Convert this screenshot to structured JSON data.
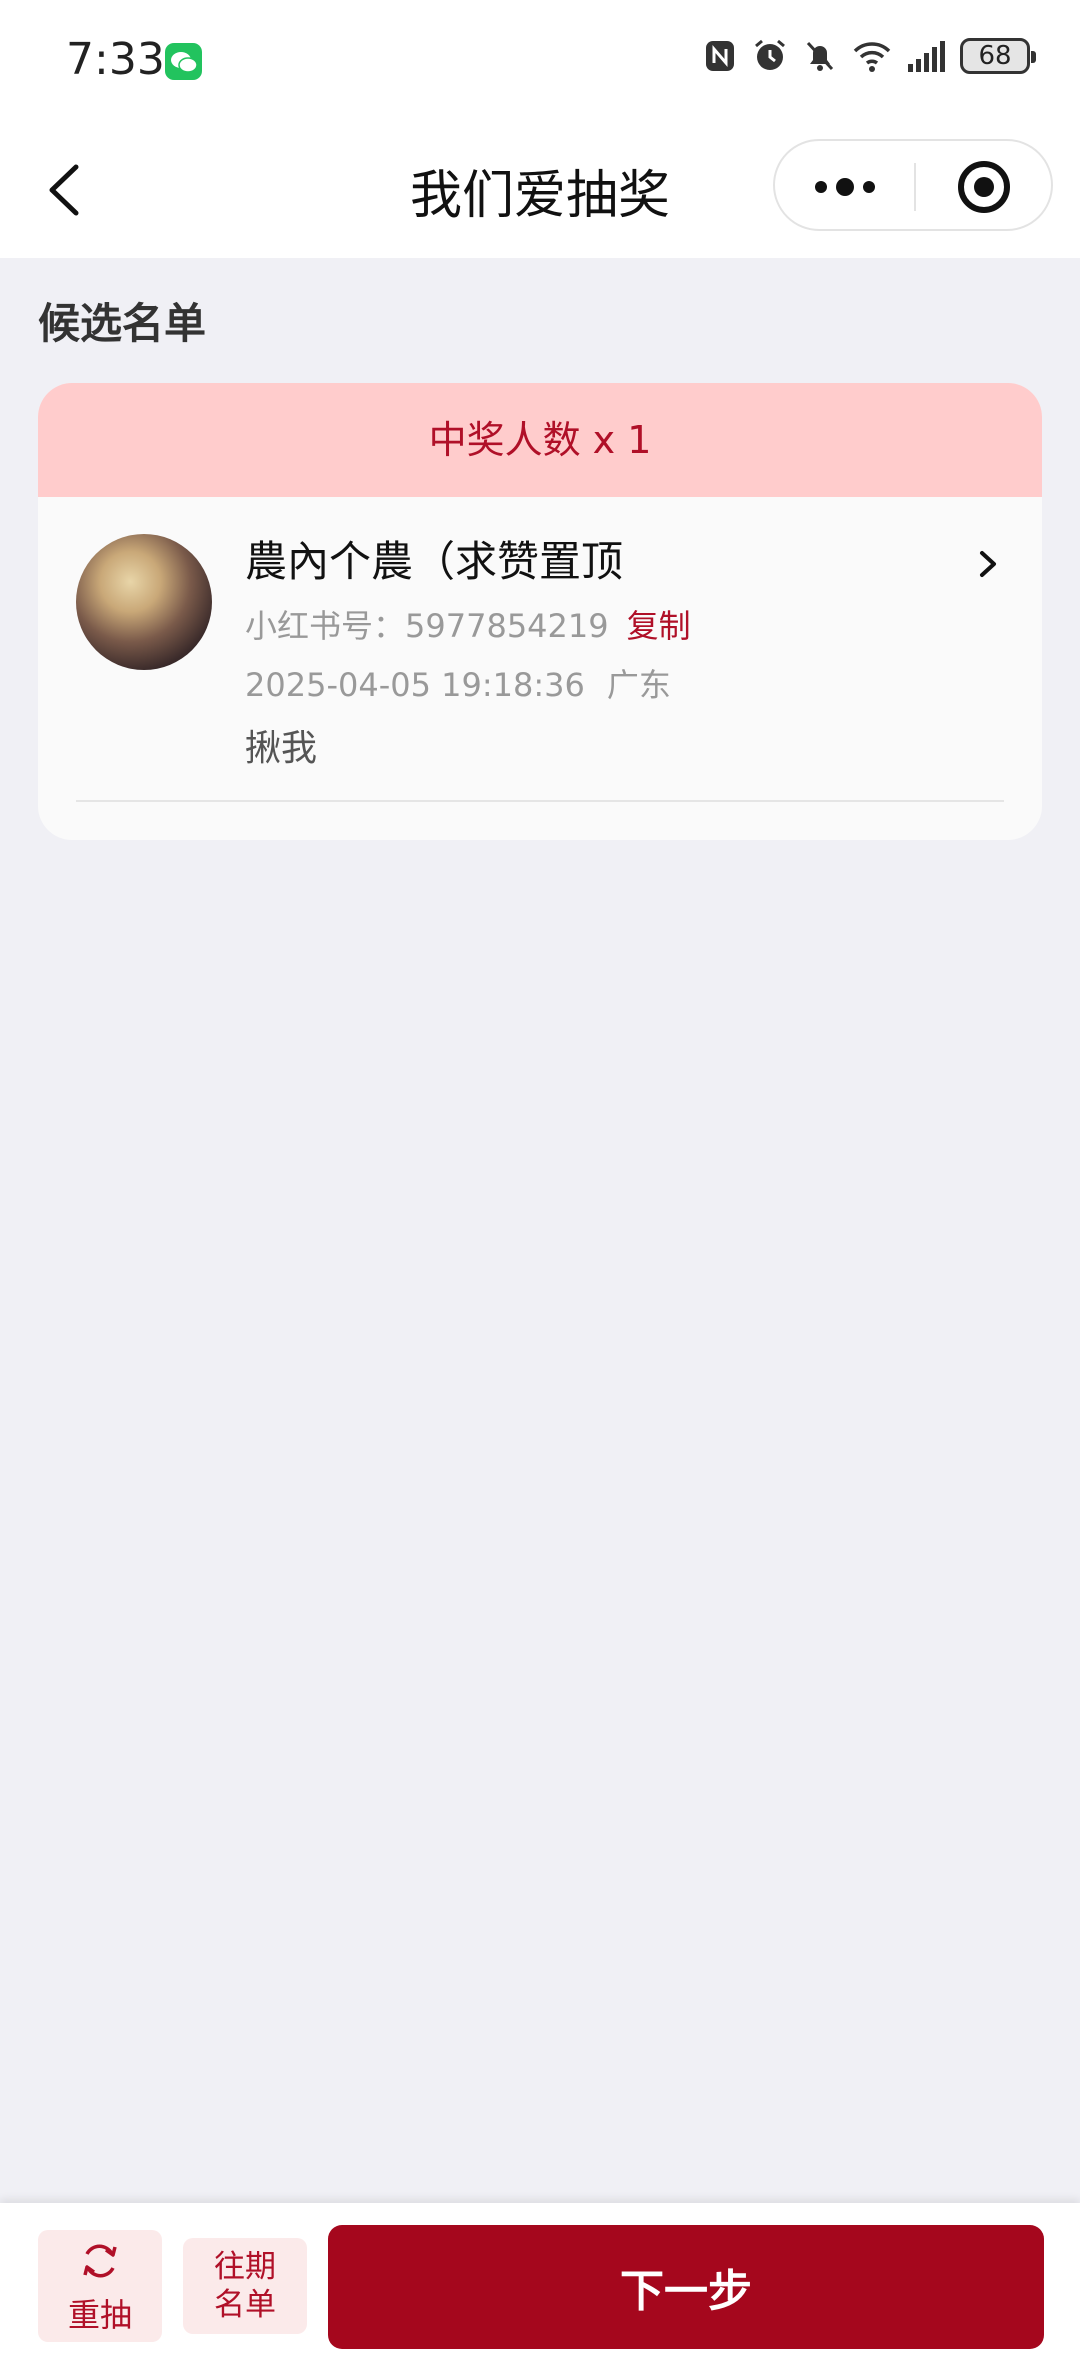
{
  "status_bar": {
    "time": "7:33",
    "battery": "68"
  },
  "nav": {
    "title": "我们爱抽奖"
  },
  "section": {
    "title": "候选名单"
  },
  "card": {
    "header": "中奖人数 x 1",
    "entry": {
      "name": "農內个農（求赞置顶",
      "account_label": "小红书号：",
      "account_id": "5977854219",
      "copy_label": "复制",
      "datetime": "2025-04-05 19:18:36",
      "region": "广东",
      "remark": "揪我"
    }
  },
  "bottom": {
    "redraw_label": "重抽",
    "history_line1": "往期",
    "history_line2": "名单",
    "next_label": "下一步"
  },
  "colors": {
    "accent": "#a5071d",
    "accent_text": "#b01028",
    "card_header_bg": "#ffcccc",
    "page_bg": "#f0f0f5"
  }
}
